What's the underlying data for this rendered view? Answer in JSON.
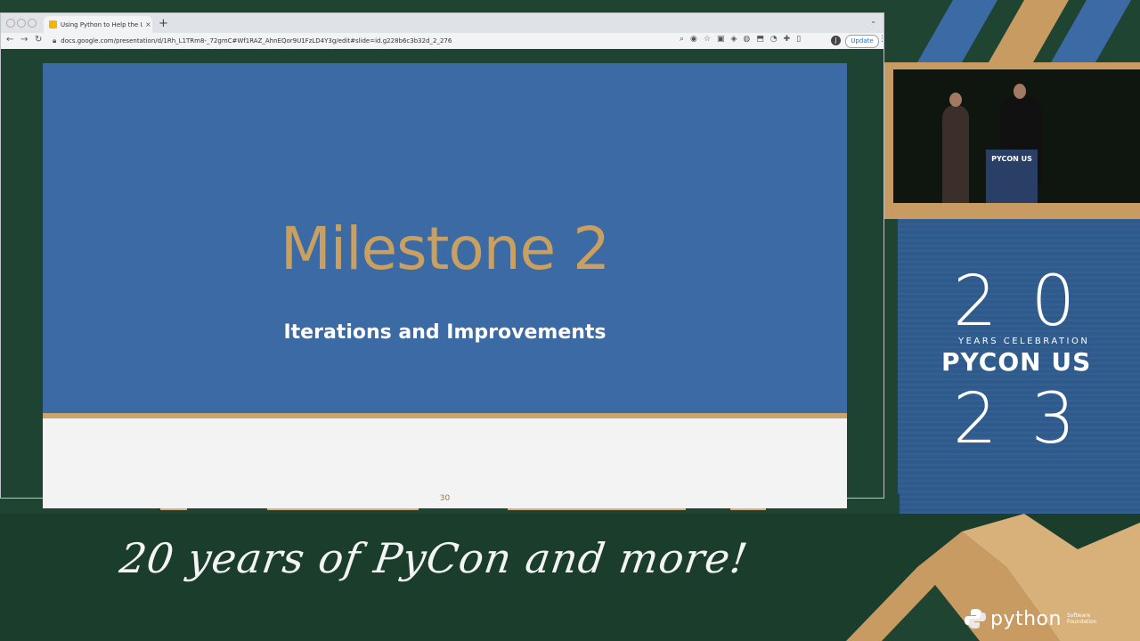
{
  "browser": {
    "tab_title": "Using Python to Help the Uni…",
    "tab_close": "×",
    "new_tab": "+",
    "url": "docs.google.com/presentation/d/1Rh_L1TRm8-_72gmC#Wf1RAZ_AhnEQor9U1FzLD4Y3g/edit#slide=id.g228b6c3b32d_2_276",
    "update_label": "Update",
    "avatar_letter": "J"
  },
  "slide": {
    "title": "Milestone 2",
    "subtitle": "Iterations and Improvements",
    "page_number": "30"
  },
  "stream": {
    "tagline": "20 years of PyCon and more!",
    "podium_label": "PYCON US",
    "brand_top": "20",
    "brand_years": "YEARS CELEBRATION",
    "brand_name": "PYCON US",
    "brand_bottom": "23",
    "python_logo": "python",
    "python_logo_small": "Software Foundation"
  },
  "colors": {
    "slide_blue": "#3b6aa5",
    "slide_gold": "#c9a05f",
    "frame_green": "#1f4431",
    "accent_gold": "#c89b63",
    "brand_blue": "#2e5a8c"
  }
}
